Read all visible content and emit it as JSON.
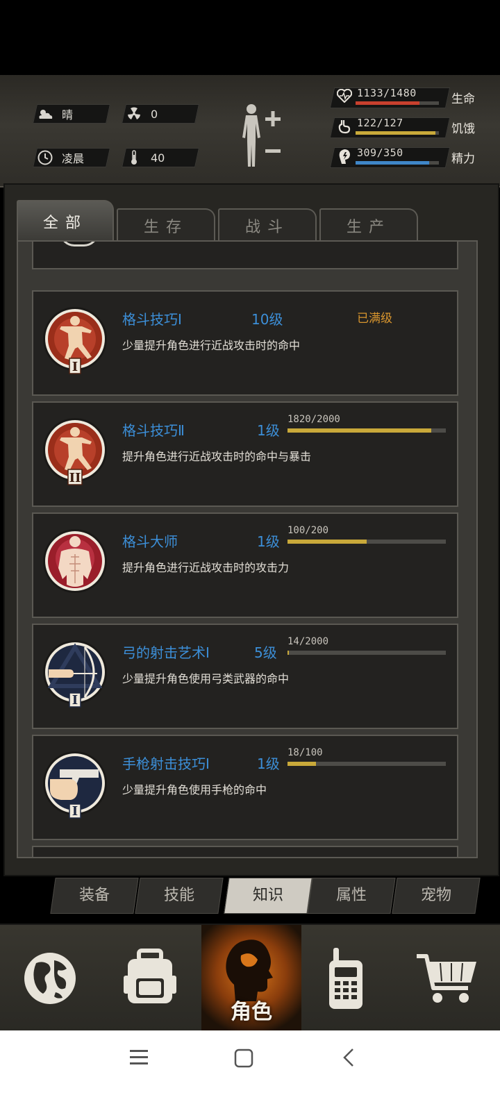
{
  "status": {
    "weather": "晴",
    "radiation": "0",
    "time_of_day": "凌晨",
    "temperature": "40",
    "stats": [
      {
        "label": "生命",
        "value": "1133/1480",
        "fraction": 0.766,
        "color": "#c8402e",
        "icon": "heart-icon"
      },
      {
        "label": "饥饿",
        "value": "122/127",
        "fraction": 0.961,
        "color": "#c9a93a",
        "icon": "stomach-icon"
      },
      {
        "label": "精力",
        "value": "309/350",
        "fraction": 0.883,
        "color": "#3f86c8",
        "icon": "energy-icon"
      }
    ]
  },
  "category_tabs": [
    "全部",
    "生存",
    "战斗",
    "生产"
  ],
  "active_category": "全部",
  "skills": [
    {
      "name": "格斗技巧Ⅰ",
      "level": "10级",
      "max_label": "已满级",
      "xp": "",
      "fraction": null,
      "desc": "少量提升角色进行近战攻击时的命中",
      "icon": "martial-arts-icon",
      "numeral": "I"
    },
    {
      "name": "格斗技巧Ⅱ",
      "level": "1级",
      "max_label": "",
      "xp": "1820/2000",
      "fraction": 0.91,
      "desc": "提升角色进行近战攻击时的命中与暴击",
      "icon": "martial-arts-icon",
      "numeral": "II"
    },
    {
      "name": "格斗大师",
      "level": "1级",
      "max_label": "",
      "xp": "100/200",
      "fraction": 0.5,
      "desc": "提升角色进行近战攻击时的攻击力",
      "icon": "muscle-icon",
      "numeral": ""
    },
    {
      "name": "弓的射击艺术Ⅰ",
      "level": "5级",
      "max_label": "",
      "xp": "14/2000",
      "fraction": 0.007,
      "desc": "少量提升角色使用弓类武器的命中",
      "icon": "archery-icon",
      "numeral": "I"
    },
    {
      "name": "手枪射击技巧Ⅰ",
      "level": "1级",
      "max_label": "",
      "xp": "18/100",
      "fraction": 0.18,
      "desc": "少量提升角色使用手枪的命中",
      "icon": "pistol-icon",
      "numeral": "I"
    }
  ],
  "sub_tabs": [
    "装备",
    "技能",
    "知识",
    "属性",
    "宠物"
  ],
  "active_sub_tab": "知识",
  "bottom_nav": {
    "active_label": "角色"
  }
}
